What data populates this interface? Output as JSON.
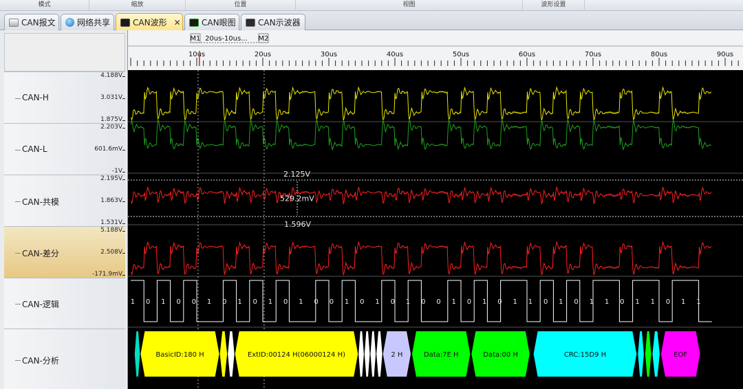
{
  "ribbon": {
    "groups": [
      {
        "label": "模式"
      },
      {
        "label": "缩放"
      },
      {
        "label": "位置"
      },
      {
        "label": "视图"
      },
      {
        "label": "波形设置"
      }
    ]
  },
  "tabs": [
    {
      "label": "CAN报文",
      "icon": "message-icon"
    },
    {
      "label": "网络共享",
      "icon": "globe-icon"
    },
    {
      "label": "CAN波形",
      "icon": "waveform-icon",
      "active": true,
      "close": "✕"
    },
    {
      "label": "CAN眼图",
      "icon": "eye-diagram-icon"
    },
    {
      "label": "CAN示波器",
      "icon": "oscilloscope-icon"
    }
  ],
  "markers": {
    "m1": "M1",
    "m2": "M2",
    "delta": "20us-10us..."
  },
  "time_axis": {
    "ticks": [
      "10us",
      "20us",
      "30us",
      "40us",
      "50us",
      "60us",
      "70us",
      "80us",
      "90us"
    ],
    "us_per_major": 10
  },
  "colors": {
    "can_h": "#e6e600",
    "can_l": "#1fa01f",
    "common": "#ff2020",
    "diff": "#ff2020",
    "logic": "#ffffff",
    "plot_bg": "#000000",
    "basic_id": "#ffff00",
    "ext_id": "#ffff00",
    "dlc": "#c8c8ff",
    "data": "#00ff00",
    "crc": "#00ffff",
    "eof": "#ff00ff"
  },
  "channels": [
    {
      "name": "CAN-H",
      "ylabels": [
        "4.188V",
        "3.031V",
        "1.875V"
      ]
    },
    {
      "name": "CAN-L",
      "ylabels": [
        "2.203V",
        "601.6mV",
        "-1V"
      ]
    },
    {
      "name": "CAN-共模",
      "ylabels": [
        "2.195V",
        "1.863V",
        "1.531V"
      ]
    },
    {
      "name": "CAN-差分",
      "ylabels": [
        "5.188V",
        "2.508V",
        "-171.9mV"
      ],
      "highlighted": true
    },
    {
      "name": "CAN-逻辑",
      "ylabels": []
    },
    {
      "name": "CAN-分析",
      "ylabels": []
    }
  ],
  "measurement": {
    "top": "2.125V",
    "delta": "529.2mV",
    "bottom": "1.596V"
  },
  "logic_labels": [
    "1",
    "0",
    "1",
    "0",
    "0",
    "1",
    "0",
    "1",
    "0",
    "1",
    "0",
    "1",
    "0",
    "0",
    "1",
    "0",
    "1",
    "0",
    "1",
    "0",
    "0",
    "1",
    "0",
    "1",
    "0",
    "1",
    "1",
    "0",
    "1",
    "0",
    "1",
    "1",
    "0",
    "1",
    "1",
    "0",
    "1",
    "1"
  ],
  "analysis": [
    {
      "label": "BasicID:180 H",
      "color": "#ffff00",
      "t0": 1.5,
      "t1": 13.4
    },
    {
      "label": "ExtID:00124 H(06000124 H)",
      "color": "#ffff00",
      "t0": 15.8,
      "t1": 34.4
    },
    {
      "label": "2 H",
      "color": "#c8c8ff",
      "t0": 38.2,
      "t1": 42.4
    },
    {
      "label": "Data:7E H",
      "color": "#00ff00",
      "t0": 42.6,
      "t1": 51.4
    },
    {
      "label": "Data:00 H",
      "color": "#00ff00",
      "t0": 51.6,
      "t1": 60.4
    },
    {
      "label": "CRC:15D9 H",
      "color": "#00ffff",
      "t0": 61.0,
      "t1": 76.6
    },
    {
      "label": "EOF",
      "color": "#ff00ff",
      "t0": 80.3,
      "t1": 86.2
    }
  ]
}
